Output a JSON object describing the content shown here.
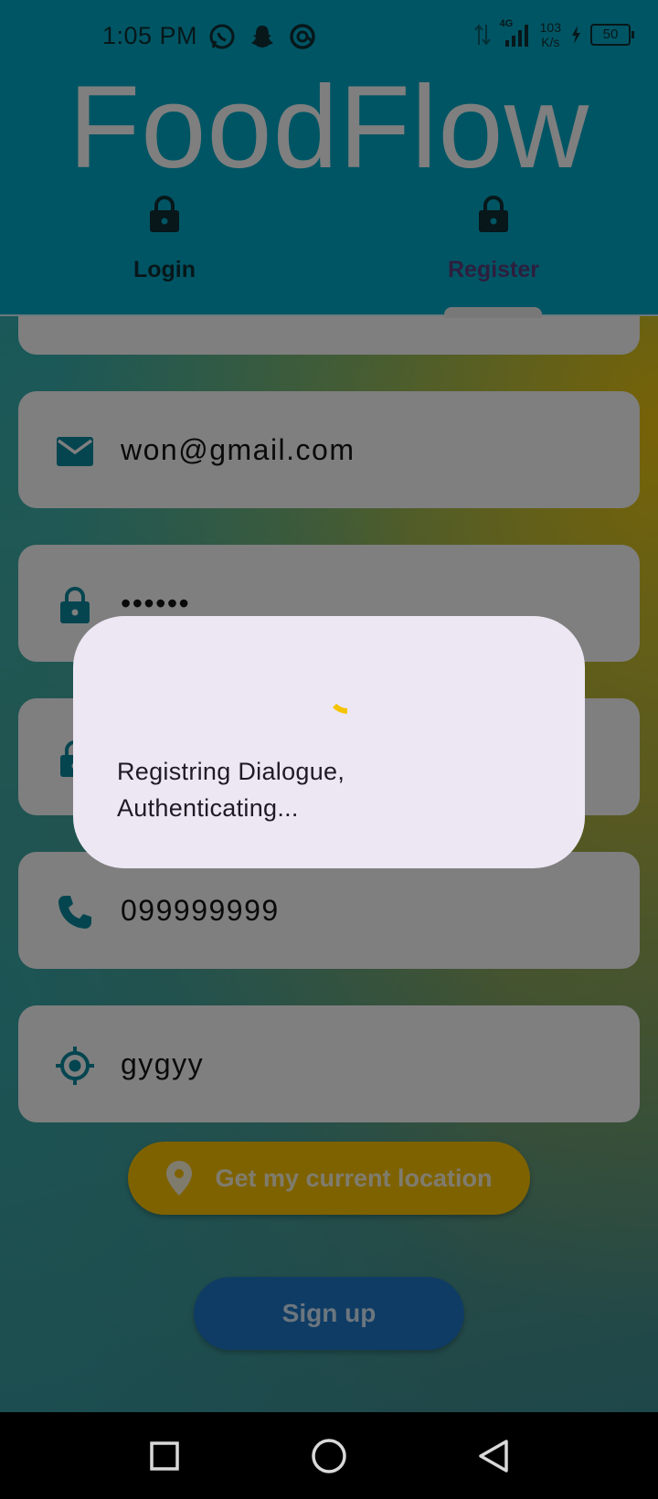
{
  "status_bar": {
    "time": "1:05 PM",
    "network_type": "4G",
    "speed_value": "103",
    "speed_unit": "K/s",
    "battery": "50",
    "icons": [
      "whatsapp-icon",
      "snapchat-icon",
      "at-sign-icon",
      "data-arrows-icon",
      "signal-icon",
      "charging-icon",
      "battery-icon"
    ]
  },
  "app": {
    "brand": "FoodFlow",
    "tabs": [
      {
        "label": "Login",
        "icon": "lock-icon",
        "selected": false
      },
      {
        "label": "Register",
        "icon": "lock-icon",
        "selected": true
      }
    ]
  },
  "form": {
    "email": {
      "value": "won@gmail.com",
      "icon": "mail-icon"
    },
    "password": {
      "value": "••••••",
      "icon": "lock-icon"
    },
    "confirm_password": {
      "icon": "lock-icon"
    },
    "phone": {
      "value": "099999999",
      "icon": "phone-icon"
    },
    "location": {
      "value": "gygyy",
      "icon": "crosshair-icon"
    },
    "get_location_label": "Get my current location",
    "signup_label": "Sign up"
  },
  "dialog": {
    "message_line1": "Registring Dialogue,",
    "message_line2": "Authenticating..."
  },
  "colors": {
    "header": "#00aac8",
    "accent_teal": "#0a8ba0",
    "location_button": "#ffc400",
    "signup_button": "#1e78c8",
    "dialog_bg": "#ede7f4",
    "spinner": "#f5c400"
  },
  "nav_bar": {
    "icons": [
      "recents-square-icon",
      "home-circle-icon",
      "back-triangle-icon"
    ]
  }
}
